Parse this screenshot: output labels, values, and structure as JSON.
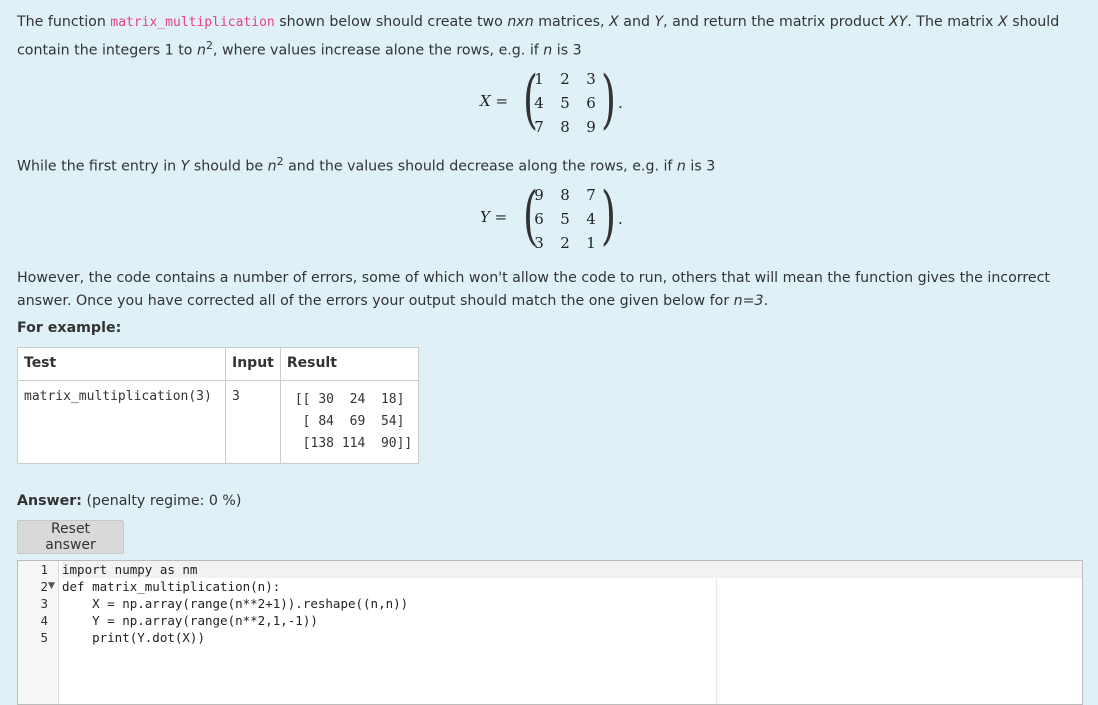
{
  "intro": {
    "t1": "The function ",
    "fn_name": "matrix_multiplication",
    "t2": " shown below should create two ",
    "nxn": "nxn",
    "t3": " matrices, ",
    "X": "X",
    "t4": " and ",
    "Y": "Y",
    "t5": ", and return the matrix product ",
    "XY": "XY",
    "t6": ". The matrix ",
    "X2": "X",
    "t7": " should contain the integers 1 to ",
    "n": "n",
    "sup": "2",
    "t8": ", where values increase alone the rows, e.g. if ",
    "n2": "n",
    "t9": " is 3"
  },
  "matrix_x": {
    "lhs": "X =",
    "values": [
      "1",
      "2",
      "3",
      "4",
      "5",
      "6",
      "7",
      "8",
      "9"
    ],
    "dot": "."
  },
  "mid": {
    "t1": "While the first entry in ",
    "Y": "Y",
    "t2": " should be ",
    "n": "n",
    "sup": "2",
    "t3": " and the values should decrease along the rows, e.g. if ",
    "n2": "n",
    "t4": " is 3"
  },
  "matrix_y": {
    "lhs": "Y =",
    "values": [
      "9",
      "8",
      "7",
      "6",
      "5",
      "4",
      "3",
      "2",
      "1"
    ],
    "dot": "."
  },
  "outro": {
    "t1": "However, the code contains a number of errors, some of which won't allow the code to run, others that will mean the function gives the incorrect answer. Once you have corrected all of the errors your output should match the one given below for ",
    "neq": "n=3",
    "t2": "."
  },
  "example_label": "For example:",
  "table": {
    "headers": [
      "Test",
      "Input",
      "Result"
    ],
    "test": "matrix_multiplication(3)",
    "input": "3",
    "result": "[[ 30  24  18]\n [ 84  69  54]\n [138 114  90]]"
  },
  "answer": {
    "label": "Answer:",
    "penalty": "(penalty regime: 0 %)",
    "reset": "Reset answer"
  },
  "code": {
    "line_numbers": [
      "1",
      "2",
      "3",
      "4",
      "5"
    ],
    "lines": [
      "import numpy as nm",
      "def matrix_multiplication(n):",
      "    X = np.array(range(n**2+1)).reshape((n,n))",
      "    Y = np.array(range(n**2,1,-1))",
      "    print(Y.dot(X))"
    ]
  }
}
